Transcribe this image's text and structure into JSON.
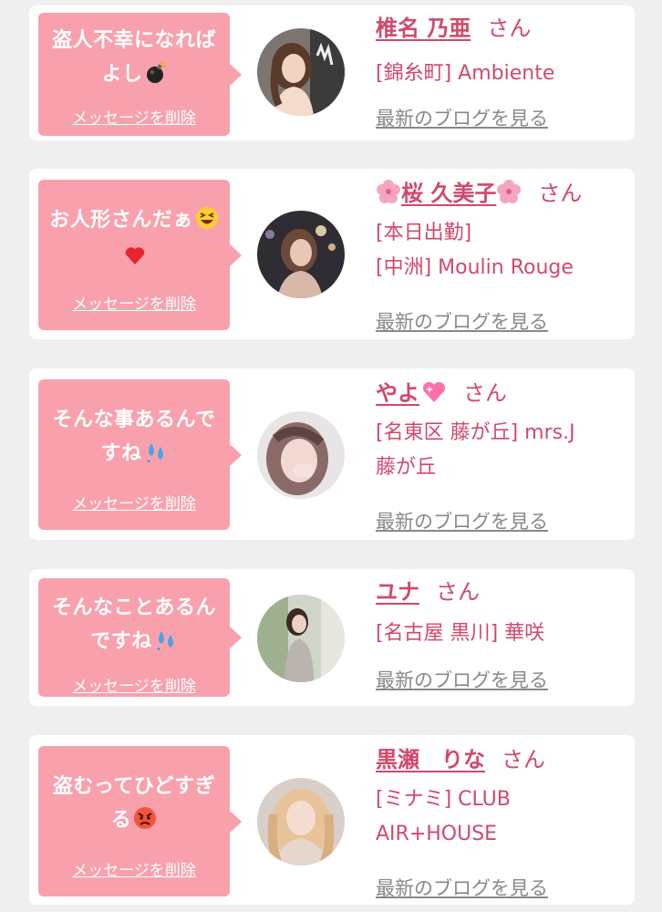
{
  "cards": [
    {
      "message_lines": [
        "盗人不幸になれば",
        "よし"
      ],
      "message_emoji": "bomb-icon",
      "delete_label": "メッセージを削除",
      "name": "椎名 乃亜",
      "honorific": "さん",
      "shop_lines": [
        "[錦糸町] Ambiente"
      ],
      "blog_label": "最新のブログを見る"
    },
    {
      "message_lines": [
        "お人形さんだぁ",
        ""
      ],
      "message_emoji": "grinning-squint-face-icon, red-heart-icon",
      "delete_label": "メッセージを削除",
      "name": "桜 久美子",
      "honorific": "さん",
      "shop_lines": [
        "[本日出勤]",
        "[中洲] Moulin Rouge"
      ],
      "blog_label": "最新のブログを見る"
    },
    {
      "message_lines": [
        "そんな事あるんで",
        "すね"
      ],
      "message_emoji": "sweat-drops-icon",
      "delete_label": "メッセージを削除",
      "name": "やよ",
      "honorific": "さん",
      "shop_lines": [
        "[名東区 藤が丘] mrs.J",
        "藤が丘"
      ],
      "blog_label": "最新のブログを見る"
    },
    {
      "message_lines": [
        "そんなことあるん",
        "ですね"
      ],
      "message_emoji": "sweat-drops-icon",
      "delete_label": "メッセージを削除",
      "name": "ユナ",
      "honorific": "さん",
      "shop_lines": [
        "[名古屋 黒川] 華咲"
      ],
      "blog_label": "最新のブログを見る"
    },
    {
      "message_lines": [
        "盗むってひどすぎ",
        "る"
      ],
      "message_emoji": "angry-face-icon",
      "delete_label": "メッセージを削除",
      "name": "黒瀬　りな",
      "honorific": "さん",
      "shop_lines": [
        "[ミナミ] CLUB",
        "AIR+HOUSE"
      ],
      "blog_label": "最新のブログを見る"
    }
  ],
  "colors": {
    "accent_pink": "#d1496b",
    "bubble_pink": "#f8a1ad",
    "link_gray": "#888888",
    "background": "#efefef"
  }
}
